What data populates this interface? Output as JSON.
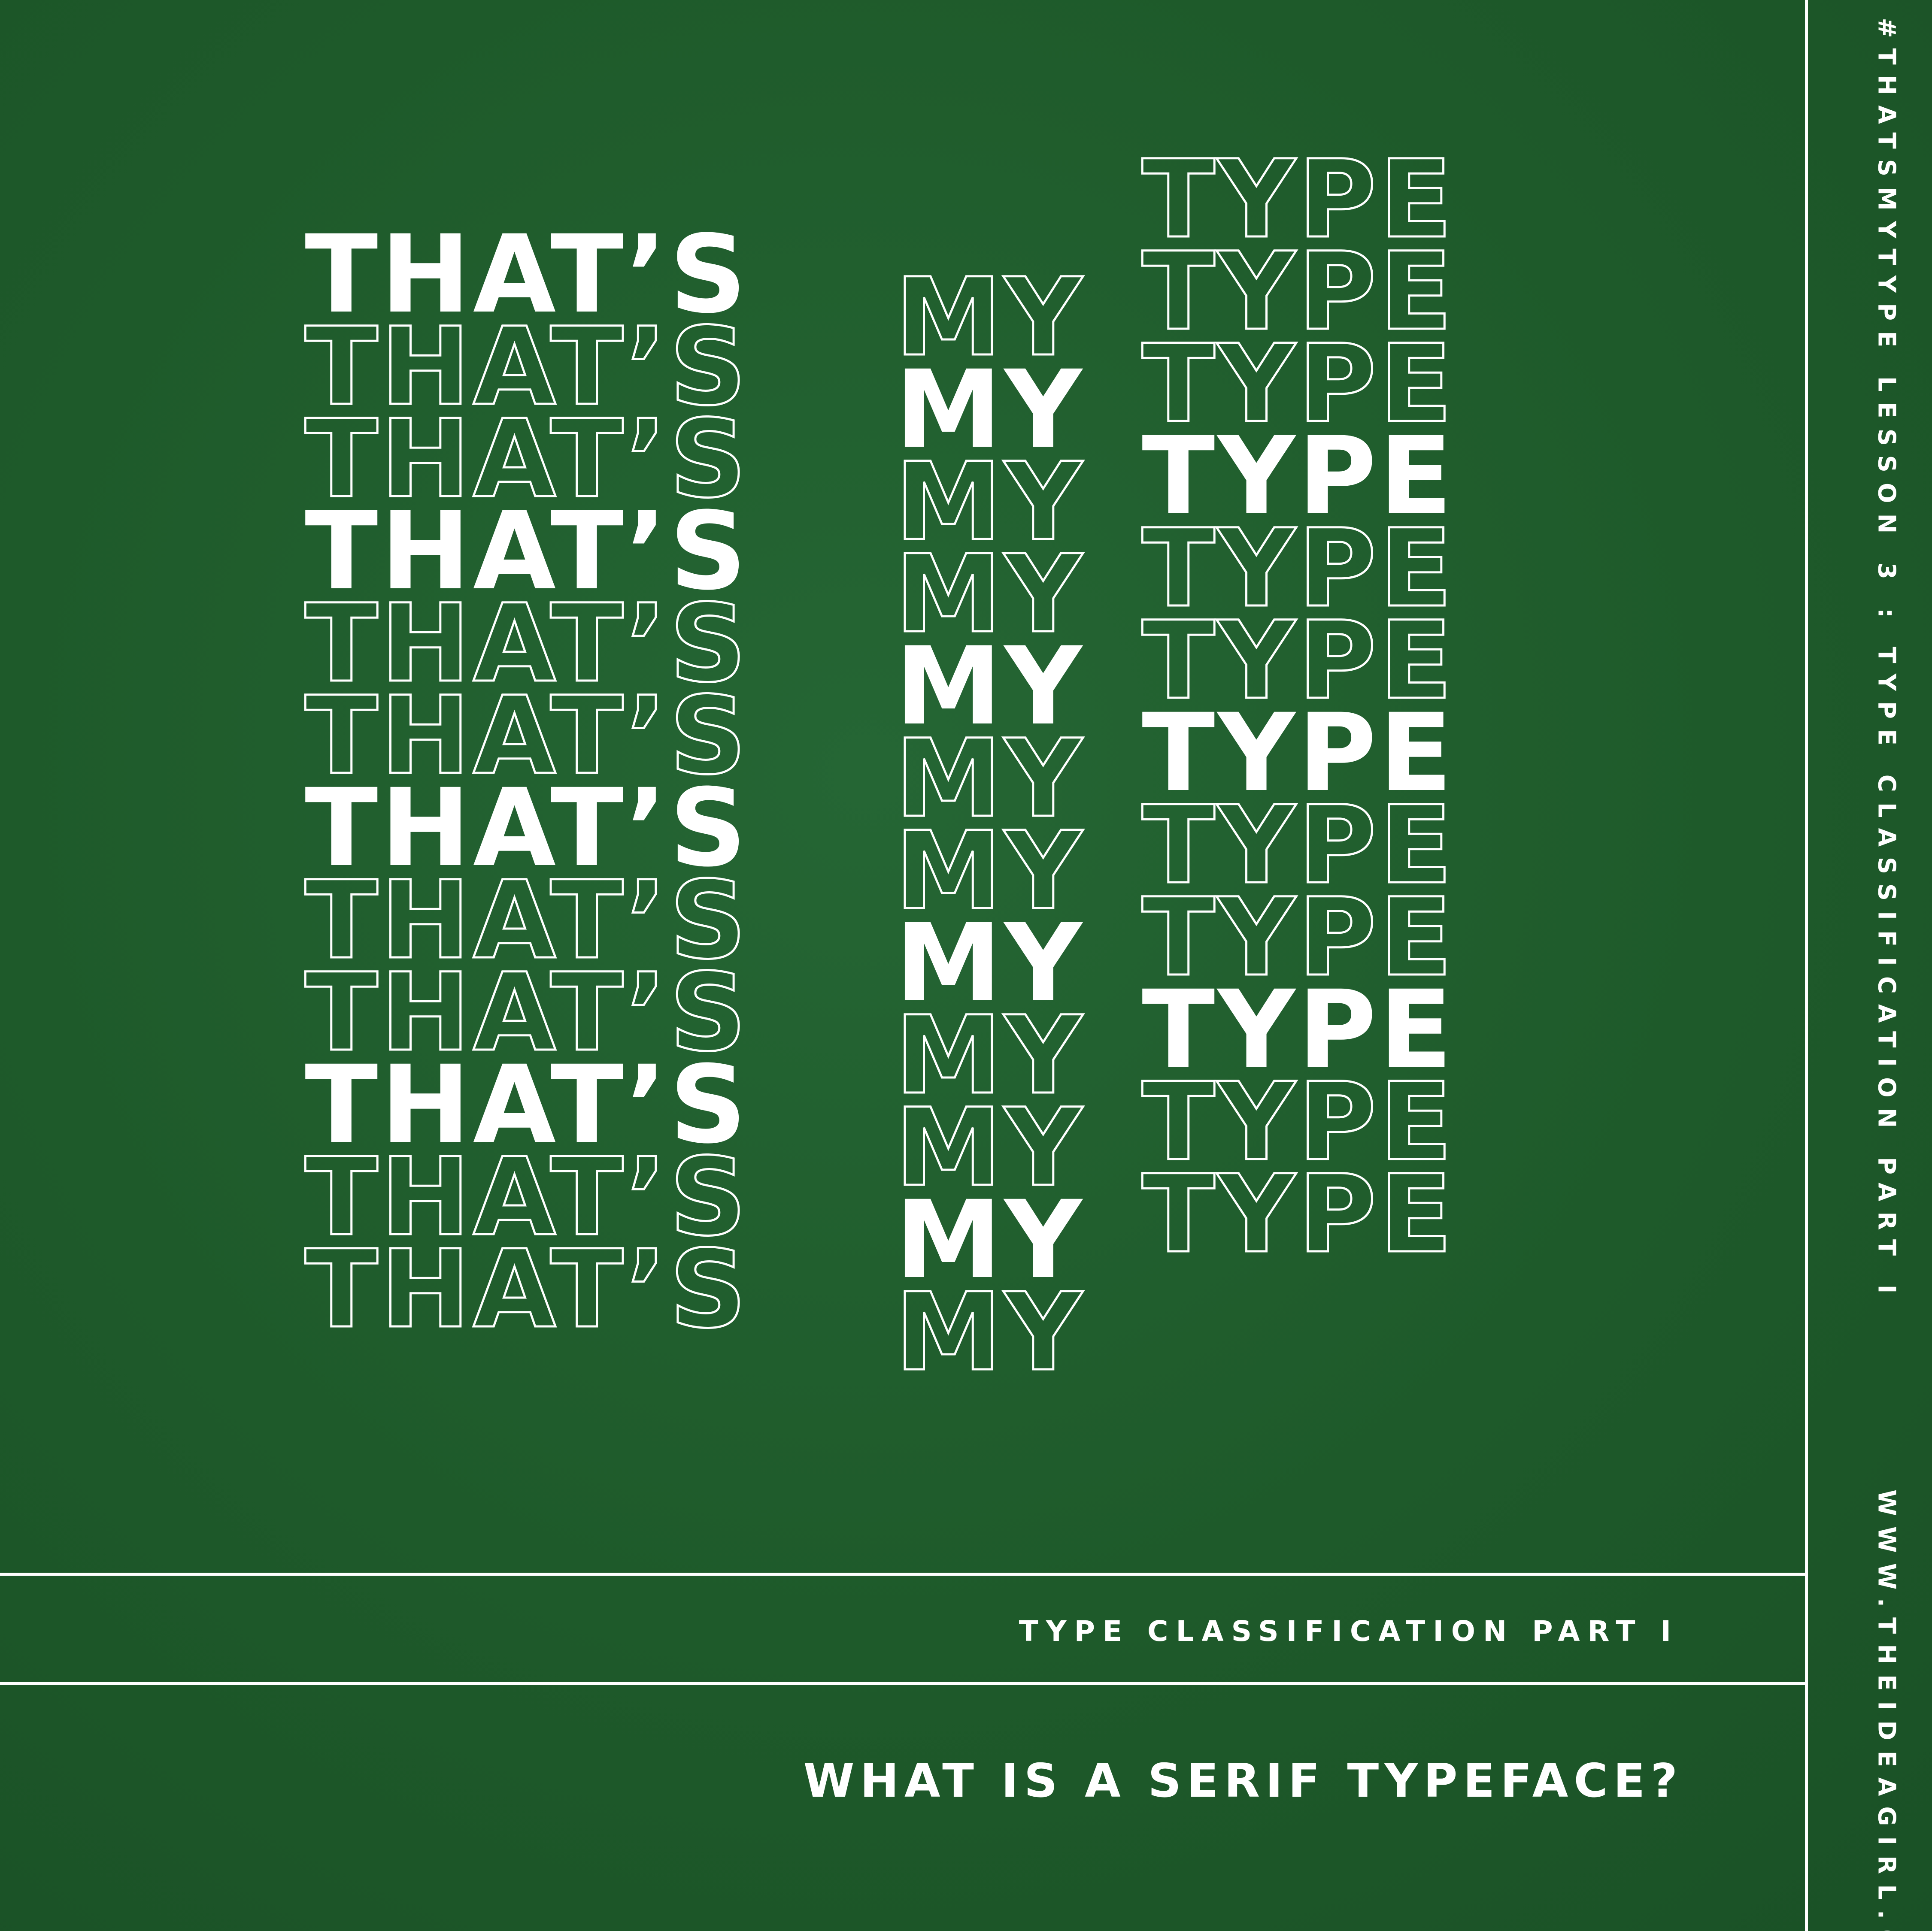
{
  "poster": {
    "headline_rows": [
      {
        "thats": "THAT’S",
        "my": "",
        "type": "TYPE",
        "thats_style": "solid",
        "my_style": "outline",
        "type_style": "outline"
      },
      {
        "thats": "THAT’S",
        "my": "MY",
        "type": "TYPE",
        "thats_style": "outline",
        "my_style": "outline",
        "type_style": "outline"
      },
      {
        "thats": "THAT’S",
        "my": "MY",
        "type": "TYPE",
        "thats_style": "outline",
        "my_style": "solid",
        "type_style": "outline"
      },
      {
        "thats": "THAT’S",
        "my": "MY",
        "type": "TYPE",
        "thats_style": "solid",
        "my_style": "outline",
        "type_style": "solid"
      },
      {
        "thats": "THAT’S",
        "my": "MY",
        "type": "TYPE",
        "thats_style": "outline",
        "my_style": "outline",
        "type_style": "outline"
      },
      {
        "thats": "THAT’S",
        "my": "MY",
        "type": "TYPE",
        "thats_style": "outline",
        "my_style": "solid",
        "type_style": "outline"
      },
      {
        "thats": "THAT’S",
        "my": "MY",
        "type": "TYPE",
        "thats_style": "solid",
        "my_style": "outline",
        "type_style": "solid"
      },
      {
        "thats": "THAT’S",
        "my": "MY",
        "type": "TYPE",
        "thats_style": "outline",
        "my_style": "outline",
        "type_style": "outline"
      },
      {
        "thats": "THAT’S",
        "my": "MY",
        "type": "TYPE",
        "thats_style": "outline",
        "my_style": "solid",
        "type_style": "outline"
      },
      {
        "thats": "THAT’S",
        "my": "MY",
        "type": "TYPE",
        "thats_style": "solid",
        "my_style": "outline",
        "type_style": "solid"
      },
      {
        "thats": "THAT’S",
        "my": "MY",
        "type": "TYPE",
        "thats_style": "outline",
        "my_style": "outline",
        "type_style": "outline"
      },
      {
        "thats": "THAT’S",
        "my": "MY",
        "type": "TYPE",
        "thats_style": "outline",
        "my_style": "solid",
        "type_style": "outline"
      },
      {
        "thats": "",
        "my": "MY",
        "type": "",
        "thats_style": "outline",
        "my_style": "outline",
        "type_style": "outline"
      }
    ],
    "headline_last_type": "TYPE",
    "subtitle": "TYPE CLASSIFICATION PART I",
    "question": "WHAT IS A SERIF TYPEFACE?",
    "side_lesson": "#THATSMYTYPE LESSON 3 : TYPE CLASSIFICATION PART I",
    "side_url": "WWW.THEIDEAGIRL.CO"
  },
  "colors": {
    "background": "#1e5a2a",
    "foreground": "#ffffff"
  }
}
